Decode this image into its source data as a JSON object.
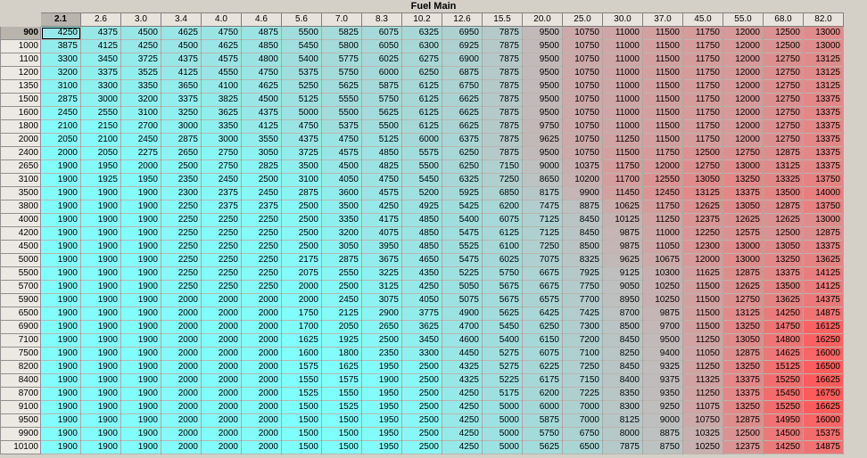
{
  "title": "Fuel Main",
  "columns": [
    "2.1",
    "2.6",
    "3.0",
    "3.4",
    "4.0",
    "4.6",
    "5.6",
    "7.0",
    "8.3",
    "10.2",
    "12.6",
    "15.5",
    "20.0",
    "25.0",
    "30.0",
    "37.0",
    "45.0",
    "55.0",
    "68.0",
    "82.0"
  ],
  "rows": [
    {
      "label": "900",
      "values": [
        4250,
        4375,
        4500,
        4625,
        4750,
        4875,
        5500,
        5825,
        6075,
        6325,
        6950,
        7875,
        9500,
        10750,
        11000,
        11500,
        11750,
        12000,
        12500,
        13000
      ]
    },
    {
      "label": "1000",
      "values": [
        3875,
        4125,
        4250,
        4500,
        4625,
        4850,
        5450,
        5800,
        6050,
        6300,
        6925,
        7875,
        9500,
        10750,
        11000,
        11500,
        11750,
        12000,
        12500,
        13000
      ]
    },
    {
      "label": "1100",
      "values": [
        3300,
        3450,
        3725,
        4375,
        4575,
        4800,
        5400,
        5775,
        6025,
        6275,
        6900,
        7875,
        9500,
        10750,
        11000,
        11500,
        11750,
        12000,
        12750,
        13125
      ]
    },
    {
      "label": "1200",
      "values": [
        3200,
        3375,
        3525,
        4125,
        4550,
        4750,
        5375,
        5750,
        6000,
        6250,
        6875,
        7875,
        9500,
        10750,
        11000,
        11500,
        11750,
        12000,
        12750,
        13125
      ]
    },
    {
      "label": "1350",
      "values": [
        3100,
        3300,
        3350,
        3650,
        4100,
        4625,
        5250,
        5625,
        5875,
        6125,
        6750,
        7875,
        9500,
        10750,
        11000,
        11500,
        11750,
        12000,
        12750,
        13125
      ]
    },
    {
      "label": "1500",
      "values": [
        2875,
        3000,
        3200,
        3375,
        3825,
        4500,
        5125,
        5550,
        5750,
        6125,
        6625,
        7875,
        9500,
        10750,
        11000,
        11500,
        11750,
        12000,
        12750,
        13375
      ]
    },
    {
      "label": "1600",
      "values": [
        2450,
        2550,
        3100,
        3250,
        3625,
        4375,
        5000,
        5500,
        5625,
        6125,
        6625,
        7875,
        9500,
        10750,
        11000,
        11500,
        11750,
        12000,
        12750,
        13375
      ]
    },
    {
      "label": "1800",
      "values": [
        2100,
        2150,
        2700,
        3000,
        3350,
        4125,
        4750,
        5375,
        5500,
        6125,
        6625,
        7875,
        9750,
        10750,
        11000,
        11500,
        11750,
        12000,
        12750,
        13375
      ]
    },
    {
      "label": "2000",
      "values": [
        2050,
        2100,
        2450,
        2875,
        3000,
        3550,
        4375,
        4750,
        5125,
        6000,
        6375,
        7875,
        9625,
        10750,
        11250,
        11500,
        11750,
        12000,
        12750,
        13375
      ]
    },
    {
      "label": "2400",
      "values": [
        2000,
        2050,
        2275,
        2650,
        2750,
        3050,
        3725,
        4575,
        4850,
        5575,
        6250,
        7875,
        9500,
        10750,
        11500,
        11750,
        12500,
        12750,
        12875,
        13375
      ]
    },
    {
      "label": "2650",
      "values": [
        1900,
        1950,
        2000,
        2500,
        2750,
        2825,
        3500,
        4500,
        4825,
        5500,
        6250,
        7150,
        9000,
        10375,
        11750,
        12000,
        12750,
        13000,
        13125,
        13375
      ]
    },
    {
      "label": "3100",
      "values": [
        1900,
        1925,
        1950,
        2350,
        2450,
        2500,
        3100,
        4050,
        4750,
        5450,
        6325,
        7250,
        8650,
        10200,
        11700,
        12550,
        13050,
        13250,
        13325,
        13750
      ]
    },
    {
      "label": "3500",
      "values": [
        1900,
        1900,
        1900,
        2300,
        2375,
        2450,
        2875,
        3600,
        4575,
        5200,
        5925,
        6850,
        8175,
        9900,
        11450,
        12450,
        13125,
        13375,
        13500,
        14000
      ]
    },
    {
      "label": "3800",
      "values": [
        1900,
        1900,
        1900,
        2250,
        2375,
        2375,
        2500,
        3500,
        4250,
        4925,
        5425,
        6200,
        7475,
        8875,
        10625,
        11750,
        12625,
        13050,
        12875,
        13750
      ]
    },
    {
      "label": "4000",
      "values": [
        1900,
        1900,
        1900,
        2250,
        2250,
        2250,
        2500,
        3350,
        4175,
        4850,
        5400,
        6075,
        7125,
        8450,
        10125,
        11250,
        12375,
        12625,
        12625,
        13000
      ]
    },
    {
      "label": "4200",
      "values": [
        1900,
        1900,
        1900,
        2250,
        2250,
        2250,
        2500,
        3200,
        4075,
        4850,
        5475,
        6125,
        7125,
        8450,
        9875,
        11000,
        12250,
        12575,
        12500,
        12875
      ]
    },
    {
      "label": "4500",
      "values": [
        1900,
        1900,
        1900,
        2250,
        2250,
        2250,
        2500,
        3050,
        3950,
        4850,
        5525,
        6100,
        7250,
        8500,
        9875,
        11050,
        12300,
        13000,
        13050,
        13375
      ]
    },
    {
      "label": "5000",
      "values": [
        1900,
        1900,
        1900,
        2250,
        2250,
        2250,
        2175,
        2875,
        3675,
        4650,
        5475,
        6025,
        7075,
        8325,
        9625,
        10675,
        12000,
        13000,
        13250,
        13625
      ]
    },
    {
      "label": "5500",
      "values": [
        1900,
        1900,
        1900,
        2250,
        2250,
        2250,
        2075,
        2550,
        3225,
        4350,
        5225,
        5750,
        6675,
        7925,
        9125,
        10300,
        11625,
        12875,
        13375,
        14125
      ]
    },
    {
      "label": "5700",
      "values": [
        1900,
        1900,
        1900,
        2250,
        2250,
        2250,
        2000,
        2500,
        3125,
        4250,
        5050,
        5675,
        6675,
        7750,
        9050,
        10250,
        11500,
        12625,
        13500,
        14125
      ]
    },
    {
      "label": "5900",
      "values": [
        1900,
        1900,
        1900,
        2000,
        2000,
        2000,
        2000,
        2450,
        3075,
        4050,
        5075,
        5675,
        6575,
        7700,
        8950,
        10250,
        11500,
        12750,
        13625,
        14375
      ]
    },
    {
      "label": "6500",
      "values": [
        1900,
        1900,
        1900,
        2000,
        2000,
        2000,
        1750,
        2125,
        2900,
        3775,
        4900,
        5625,
        6425,
        7425,
        8700,
        9875,
        11500,
        13125,
        14250,
        14875
      ]
    },
    {
      "label": "6900",
      "values": [
        1900,
        1900,
        1900,
        2000,
        2000,
        2000,
        1700,
        2050,
        2650,
        3625,
        4700,
        5450,
        6250,
        7300,
        8500,
        9700,
        11500,
        13250,
        14750,
        16125
      ]
    },
    {
      "label": "7100",
      "values": [
        1900,
        1900,
        1900,
        2000,
        2000,
        2000,
        1625,
        1925,
        2500,
        3450,
        4600,
        5400,
        6150,
        7200,
        8450,
        9500,
        11250,
        13050,
        14800,
        16250
      ]
    },
    {
      "label": "7500",
      "values": [
        1900,
        1900,
        1900,
        2000,
        2000,
        2000,
        1600,
        1800,
        2350,
        3300,
        4450,
        5275,
        6075,
        7100,
        8250,
        9400,
        11050,
        12875,
        14625,
        16000
      ]
    },
    {
      "label": "8200",
      "values": [
        1900,
        1900,
        1900,
        2000,
        2000,
        2000,
        1575,
        1625,
        1950,
        2500,
        4325,
        5275,
        6225,
        7250,
        8450,
        9325,
        11250,
        13250,
        15125,
        16500
      ]
    },
    {
      "label": "8400",
      "values": [
        1900,
        1900,
        1900,
        2000,
        2000,
        2000,
        1550,
        1575,
        1900,
        2500,
        4325,
        5225,
        6175,
        7150,
        8400,
        9375,
        11325,
        13375,
        15250,
        16625
      ]
    },
    {
      "label": "8700",
      "values": [
        1900,
        1900,
        1900,
        2000,
        2000,
        2000,
        1525,
        1550,
        1950,
        2500,
        4250,
        5175,
        6200,
        7225,
        8350,
        9350,
        11250,
        13375,
        15450,
        16750
      ]
    },
    {
      "label": "9100",
      "values": [
        1900,
        1900,
        1900,
        2000,
        2000,
        2000,
        1500,
        1525,
        1950,
        2500,
        4250,
        5000,
        6000,
        7000,
        8300,
        9250,
        11075,
        13250,
        15250,
        16625
      ]
    },
    {
      "label": "9500",
      "values": [
        1900,
        1900,
        1900,
        2000,
        2000,
        2000,
        1500,
        1500,
        1950,
        2500,
        4250,
        5000,
        5875,
        7000,
        8125,
        9000,
        10750,
        12875,
        14950,
        16000
      ]
    },
    {
      "label": "9900",
      "values": [
        1900,
        1900,
        1900,
        2000,
        2000,
        2000,
        1500,
        1500,
        1950,
        2500,
        4250,
        5000,
        5750,
        6750,
        8000,
        8875,
        10325,
        12500,
        14500,
        15375
      ]
    },
    {
      "label": "10100",
      "values": [
        1900,
        1900,
        1900,
        2000,
        2000,
        2000,
        1500,
        1500,
        1950,
        2500,
        4250,
        5000,
        5625,
        6500,
        7875,
        8750,
        10250,
        12375,
        14250,
        14875
      ]
    }
  ],
  "selected": {
    "row": 0,
    "col": 0
  },
  "colors": {
    "low": "#80ffff",
    "high": "#ff5a5a",
    "mid": "#bfbfbf",
    "header_bg": "#e8e4dc",
    "window_bg": "#d4d0c8"
  }
}
